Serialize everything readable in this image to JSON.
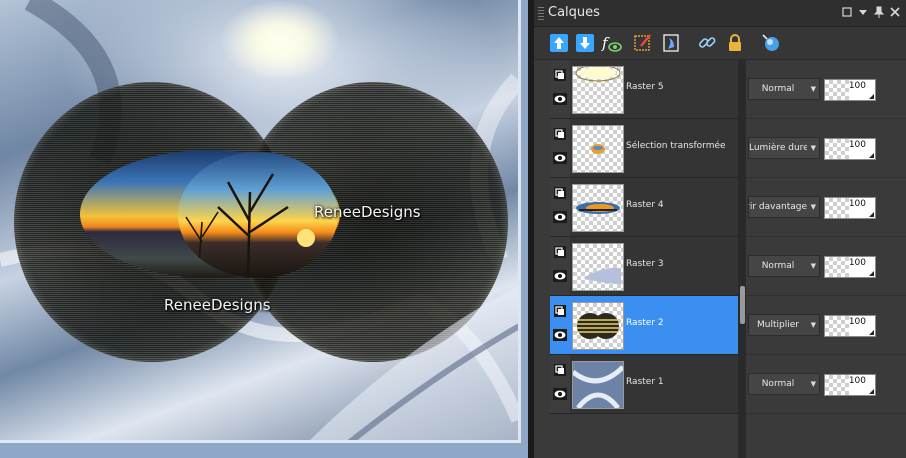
{
  "canvas": {
    "watermark_right": "ReneeDesigns",
    "watermark_left": "ReneeDesigns"
  },
  "panel": {
    "title": "Calques",
    "title_controls": [
      "restore-icon",
      "dropdown-icon",
      "pin-icon",
      "close-icon"
    ],
    "toolbar_icons": [
      "new-raster-layer-icon",
      "new-vector-layer-icon",
      "effects-layer-icon",
      "brush-layer-icon",
      "mask-layer-icon",
      "link-icon",
      "lock-icon",
      "mixer-icon"
    ],
    "layers": [
      {
        "name": "Raster 5",
        "blend": "Normal",
        "opacity": "100",
        "selected": false
      },
      {
        "name": "Sélection transformée",
        "blend": "Lumière dure",
        "opacity": "100",
        "selected": false
      },
      {
        "name": "Raster 4",
        "blend": "Assombrir davantage",
        "opacity": "100",
        "selected": false
      },
      {
        "name": "Raster 3",
        "blend": "Normal",
        "opacity": "100",
        "selected": false
      },
      {
        "name": "Raster 2",
        "blend": "Multiplier",
        "opacity": "100",
        "selected": true
      },
      {
        "name": "Raster 1",
        "blend": "Normal",
        "opacity": "100",
        "selected": false
      }
    ]
  },
  "colors": {
    "selection": "#3a8ff0",
    "panel_bg": "#3a3a3a",
    "toolbar_accent": "#39a6ff"
  }
}
